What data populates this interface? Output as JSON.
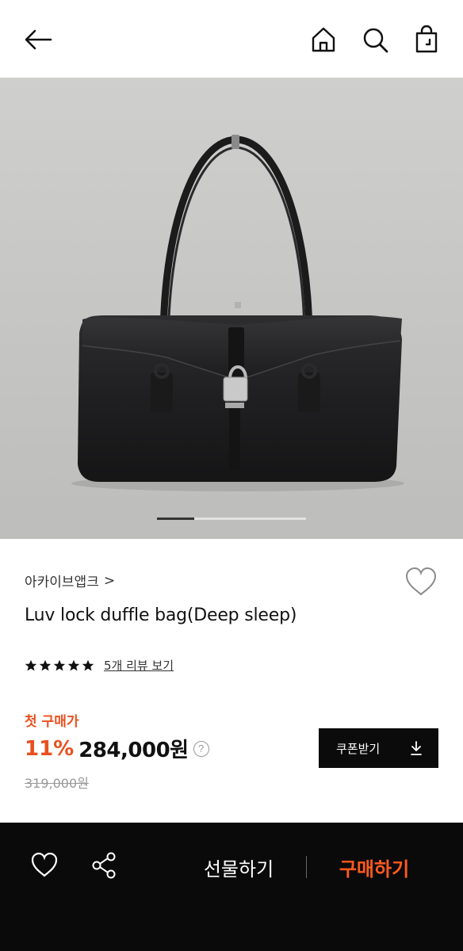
{
  "header": {
    "back_icon": "arrow-left-icon",
    "home_icon": "home-icon",
    "search_icon": "search-icon",
    "bag_icon": "shopping-bag-icon"
  },
  "gallery": {
    "image_alt": "black leather duffle bag",
    "current_index": 1,
    "indicator_fraction": 0.25
  },
  "product": {
    "brand": "아카이브앱크",
    "brand_arrow": ">",
    "title": "Luv lock duffle bag(Deep sleep)",
    "rating": 5,
    "review_link": "5개 리뷰 보기",
    "first_purchase_label": "첫 구매가",
    "discount": "11%",
    "price": "284,000원",
    "help_glyph": "?",
    "original_price": "319,000원",
    "coupon_label": "쿠폰받기"
  },
  "bottom_bar": {
    "gift_label": "선물하기",
    "buy_label": "구매하기"
  },
  "colors": {
    "accent": "#e8501f",
    "buy_accent": "#ff5a1f",
    "bottom_bar_bg": "#0a0a0a",
    "hero_bg": "#c8c8c6"
  }
}
